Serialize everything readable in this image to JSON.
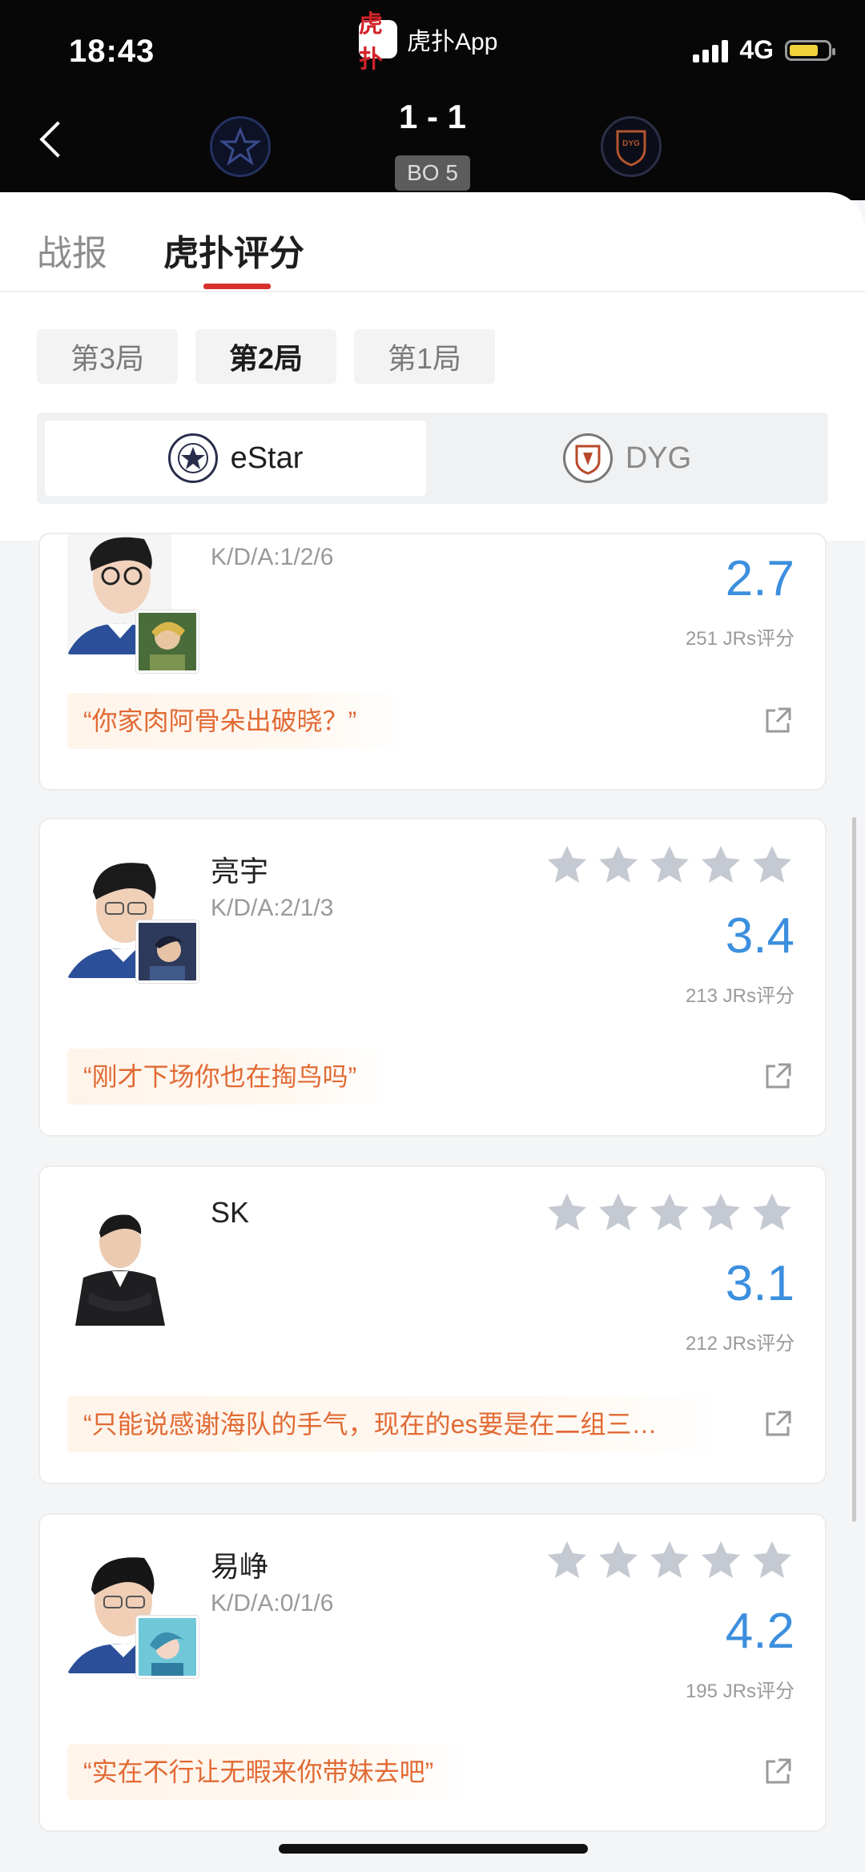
{
  "status_bar": {
    "time": "18:43",
    "app_name": "虎扑App",
    "app_logo_text": "虎扑",
    "network": "4G"
  },
  "match": {
    "score": "1 - 1",
    "format": "BO 5",
    "home_team": "eStar",
    "away_team": "DYG"
  },
  "tabs": [
    {
      "label": "战报"
    },
    {
      "label": "虎扑评分"
    }
  ],
  "active_tab": "虎扑评分",
  "rounds": [
    {
      "label": "第3局"
    },
    {
      "label": "第2局"
    },
    {
      "label": "第1局"
    }
  ],
  "active_round": "第2局",
  "team_switch": [
    {
      "label": "eStar"
    },
    {
      "label": "DYG"
    }
  ],
  "active_team": "eStar",
  "players": [
    {
      "name": "",
      "kda": "K/D/A:1/2/6",
      "score": "2.7",
      "votes": "251 JRs评分",
      "comment": "“你家肉阿骨朵出破晓？”"
    },
    {
      "name": "亮宇",
      "kda": "K/D/A:2/1/3",
      "score": "3.4",
      "votes": "213 JRs评分",
      "comment": "“刚才下场你也在掏鸟吗”"
    },
    {
      "name": "SK",
      "kda": "",
      "score": "3.1",
      "votes": "212 JRs评分",
      "comment": "“只能说感谢海队的手气，现在的es要是在二组三…"
    },
    {
      "name": "易峥",
      "kda": "K/D/A:0/1/6",
      "score": "4.2",
      "votes": "195 JRs评分",
      "comment": "“实在不行让无暇来你带妹去吧”"
    }
  ],
  "colors": {
    "accent_red": "#d6312d",
    "score_blue": "#3c8fde",
    "comment_orange": "#e16a34",
    "star_gray": "#c5c9d1"
  }
}
